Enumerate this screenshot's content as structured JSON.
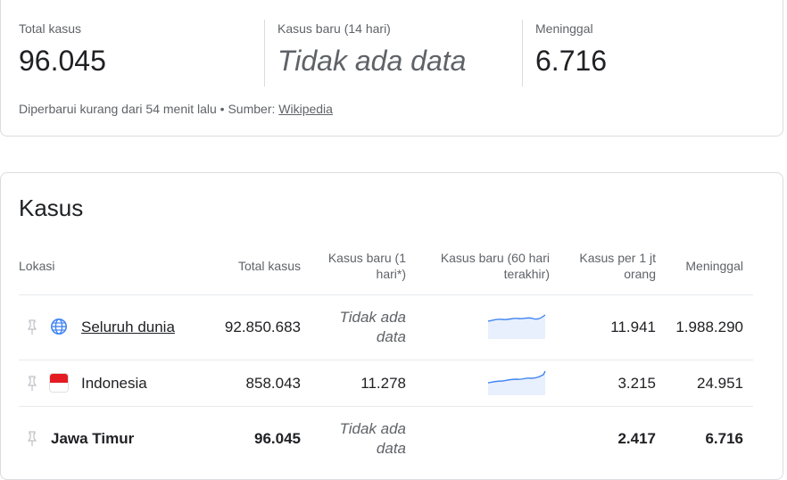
{
  "summary": {
    "total_label": "Total kasus",
    "total_value": "96.045",
    "new14_label": "Kasus baru (14 hari)",
    "new14_value": "Tidak ada data",
    "deaths_label": "Meninggal",
    "deaths_value": "6.716",
    "updated_text": "Diperbarui kurang dari 54 menit lalu • Sumber: ",
    "source_link": "Wikipedia"
  },
  "cases": {
    "title": "Kasus",
    "headers": {
      "location": "Lokasi",
      "total": "Total kasus",
      "new1_line1": "Kasus baru (1",
      "new1_line2": "hari*)",
      "new60_line1": "Kasus baru (60 hari",
      "new60_line2": "terakhir)",
      "per1m_line1": "Kasus per 1 jt",
      "per1m_line2": "orang",
      "deaths": "Meninggal"
    },
    "rows": [
      {
        "location": "Seluruh dunia",
        "total": "92.850.683",
        "new1_line1": "Tidak ada",
        "new1_line2": "data",
        "per1m": "11.941",
        "deaths": "1.988.290"
      },
      {
        "location": "Indonesia",
        "total": "858.043",
        "new1": "11.278",
        "per1m": "3.215",
        "deaths": "24.951"
      },
      {
        "location": "Jawa Timur",
        "total": "96.045",
        "new1_line1": "Tidak ada",
        "new1_line2": "data",
        "per1m": "2.417",
        "deaths": "6.716"
      }
    ]
  },
  "colors": {
    "accent_blue": "#4285f4",
    "spark_fill": "#e8f0fe",
    "flag_red": "#e41b23"
  },
  "icons": {
    "pin": "pin-icon",
    "globe": "globe-icon",
    "flag": "indonesia-flag-icon"
  }
}
